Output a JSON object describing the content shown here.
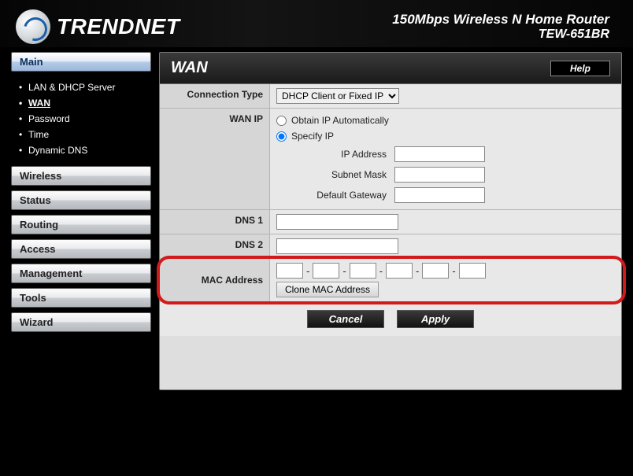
{
  "header": {
    "brand": "TRENDNET",
    "product_line1": "150Mbps Wireless N Home Router",
    "product_line2": "TEW-651BR"
  },
  "sidebar": {
    "sections": [
      {
        "label": "Main",
        "selected": true
      },
      {
        "label": "Wireless",
        "selected": false
      },
      {
        "label": "Status",
        "selected": false
      },
      {
        "label": "Routing",
        "selected": false
      },
      {
        "label": "Access",
        "selected": false
      },
      {
        "label": "Management",
        "selected": false
      },
      {
        "label": "Tools",
        "selected": false
      },
      {
        "label": "Wizard",
        "selected": false
      }
    ],
    "main_items": [
      {
        "label": "LAN & DHCP Server",
        "active": false
      },
      {
        "label": "WAN",
        "active": true
      },
      {
        "label": "Password",
        "active": false
      },
      {
        "label": "Time",
        "active": false
      },
      {
        "label": "Dynamic DNS",
        "active": false
      }
    ]
  },
  "page": {
    "title": "WAN",
    "help_label": "Help"
  },
  "form": {
    "connection_type_label": "Connection Type",
    "connection_type_value": "DHCP Client or Fixed IP",
    "wan_ip_label": "WAN IP",
    "obtain_label": "Obtain IP Automatically",
    "specify_label": "Specify IP",
    "wan_ip_mode": "specify",
    "ip_address_label": "IP Address",
    "ip_address_value": "",
    "subnet_label": "Subnet Mask",
    "subnet_value": "",
    "gateway_label": "Default Gateway",
    "gateway_value": "",
    "dns1_label": "DNS 1",
    "dns1_value": "",
    "dns2_label": "DNS 2",
    "dns2_value": "",
    "mac_label": "MAC Address",
    "mac": [
      "",
      "",
      "",
      "",
      "",
      ""
    ],
    "clone_label": "Clone MAC Address",
    "cancel_label": "Cancel",
    "apply_label": "Apply"
  }
}
